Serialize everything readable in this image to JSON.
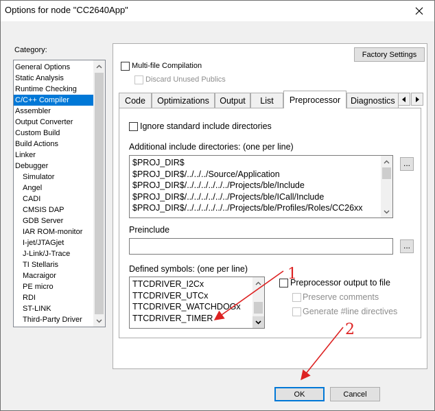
{
  "window": {
    "title": "Options for node \"CC2640App\""
  },
  "category": {
    "label": "Category:",
    "items": [
      {
        "label": "General Options",
        "sub": false,
        "selected": false
      },
      {
        "label": "Static Analysis",
        "sub": false,
        "selected": false
      },
      {
        "label": "Runtime Checking",
        "sub": false,
        "selected": false
      },
      {
        "label": "C/C++ Compiler",
        "sub": false,
        "selected": true
      },
      {
        "label": "Assembler",
        "sub": false,
        "selected": false
      },
      {
        "label": "Output Converter",
        "sub": false,
        "selected": false
      },
      {
        "label": "Custom Build",
        "sub": false,
        "selected": false
      },
      {
        "label": "Build Actions",
        "sub": false,
        "selected": false
      },
      {
        "label": "Linker",
        "sub": false,
        "selected": false
      },
      {
        "label": "Debugger",
        "sub": false,
        "selected": false
      },
      {
        "label": "Simulator",
        "sub": true,
        "selected": false
      },
      {
        "label": "Angel",
        "sub": true,
        "selected": false
      },
      {
        "label": "CADI",
        "sub": true,
        "selected": false
      },
      {
        "label": "CMSIS DAP",
        "sub": true,
        "selected": false
      },
      {
        "label": "GDB Server",
        "sub": true,
        "selected": false
      },
      {
        "label": "IAR ROM-monitor",
        "sub": true,
        "selected": false
      },
      {
        "label": "I-jet/JTAGjet",
        "sub": true,
        "selected": false
      },
      {
        "label": "J-Link/J-Trace",
        "sub": true,
        "selected": false
      },
      {
        "label": "TI Stellaris",
        "sub": true,
        "selected": false
      },
      {
        "label": "Macraigor",
        "sub": true,
        "selected": false
      },
      {
        "label": "PE micro",
        "sub": true,
        "selected": false
      },
      {
        "label": "RDI",
        "sub": true,
        "selected": false
      },
      {
        "label": "ST-LINK",
        "sub": true,
        "selected": false
      },
      {
        "label": "Third-Party Driver",
        "sub": true,
        "selected": false
      }
    ]
  },
  "factory_settings_label": "Factory Settings",
  "multifile": {
    "label": "Multi-file Compilation",
    "discard_label": "Discard Unused Publics"
  },
  "tabs": [
    "Code",
    "Optimizations",
    "Output",
    "List",
    "Preprocessor",
    "Diagnostics"
  ],
  "active_tab": "Preprocessor",
  "preprocessor": {
    "ignore_std_label": "Ignore standard include directories",
    "include_dirs_label": "Additional include directories: (one per line)",
    "include_dirs": [
      "$PROJ_DIR$",
      "$PROJ_DIR$/../../../Source/Application",
      "$PROJ_DIR$/../../../../../../Projects/ble/Include",
      "$PROJ_DIR$/../../../../../../Projects/ble/ICall/Include",
      "$PROJ_DIR$/../../../../../../Projects/ble/Profiles/Roles/CC26xx"
    ],
    "preinclude_label": "Preinclude",
    "preinclude_value": "",
    "defined_label": "Defined symbols: (one per line)",
    "defined_symbols": [
      "TTCDRIVER_I2Cx",
      "TTCDRIVER_UTCx",
      "TTCDRIVER_WATCHDOGx",
      "TTCDRIVER_TIMER"
    ],
    "pp_output_label": "Preprocessor output to file",
    "preserve_label": "Preserve comments",
    "generate_label": "Generate #line directives",
    "browse_label": "..."
  },
  "buttons": {
    "ok": "OK",
    "cancel": "Cancel"
  },
  "annotations": {
    "one": "1",
    "two": "2"
  },
  "colors": {
    "selection": "#0078d7",
    "annotation": "#dd2222"
  }
}
